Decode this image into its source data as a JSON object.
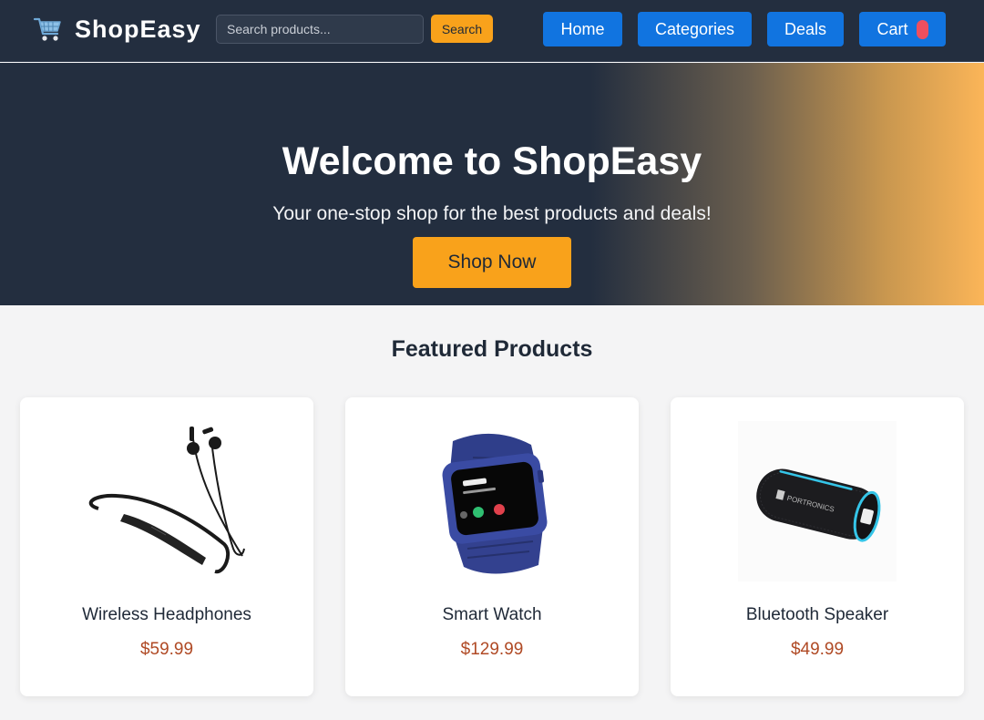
{
  "navbar": {
    "brand_icon": "shopping-cart-icon",
    "brand_name": "ShopEasy",
    "search": {
      "placeholder": "Search products...",
      "value": "",
      "button_label": "Search"
    },
    "links": [
      {
        "label": "Home"
      },
      {
        "label": "Categories"
      },
      {
        "label": "Deals"
      },
      {
        "label": "Cart",
        "badge_color": "#ef4f5f"
      }
    ]
  },
  "hero": {
    "title": "Welcome to ShopEasy",
    "subtitle": "Your one-stop shop for the best products and deals!",
    "cta_label": "Shop Now"
  },
  "featured": {
    "title": "Featured Products",
    "products": [
      {
        "name": "Wireless Headphones",
        "price": "$59.99",
        "image": "neckband-earphones-image"
      },
      {
        "name": "Smart Watch",
        "price": "$129.99",
        "image": "smart-watch-image"
      },
      {
        "name": "Bluetooth Speaker",
        "price": "$49.99",
        "image": "bluetooth-speaker-image",
        "image_text": "PORTRONICS"
      }
    ]
  },
  "colors": {
    "nav_bg": "#232e3f",
    "accent_orange": "#f9a21b",
    "nav_button_blue": "#1174e0",
    "price_color": "#b04a25",
    "page_bg": "#f4f4f5"
  }
}
